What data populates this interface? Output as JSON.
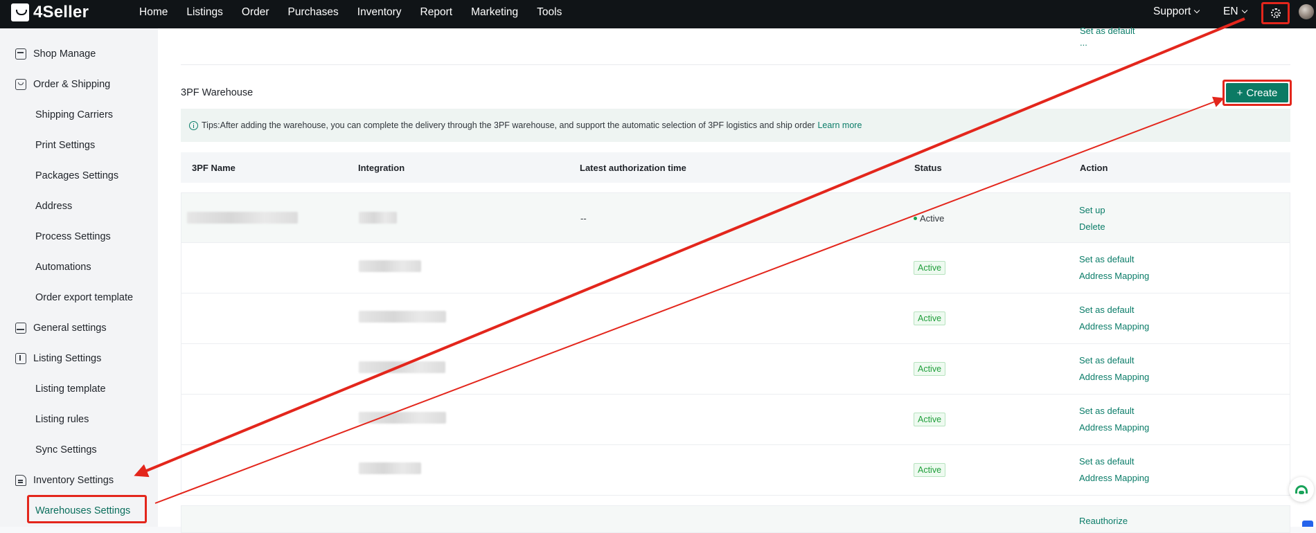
{
  "app": {
    "name": "4Seller"
  },
  "topnav": {
    "items": [
      "Home",
      "Listings",
      "Order",
      "Purchases",
      "Inventory",
      "Report",
      "Marketing",
      "Tools"
    ],
    "support": "Support",
    "language": "EN"
  },
  "sidebar": {
    "groups": [
      {
        "label": "Shop Manage",
        "icon": "store-icon"
      },
      {
        "label": "Order & Shipping",
        "icon": "order-bag-icon",
        "children": [
          "Shipping Carriers",
          "Print Settings",
          "Packages Settings",
          "Address",
          "Process Settings",
          "Automations",
          "Order export template"
        ]
      },
      {
        "label": "General settings",
        "icon": "printer-icon"
      },
      {
        "label": "Listing Settings",
        "icon": "upload-box-icon",
        "children": [
          "Listing template",
          "Listing rules",
          "Sync Settings"
        ]
      },
      {
        "label": "Inventory Settings",
        "icon": "warehouse-icon",
        "children": [
          "Warehouses Settings"
        ]
      }
    ],
    "active": "Warehouses Settings"
  },
  "main": {
    "top_link": "Set as default",
    "top_ellipsis": "...",
    "section_title": "3PF Warehouse",
    "create_button": "Create",
    "tips": "Tips:After adding the warehouse, you can complete the delivery through the 3PF warehouse, and support the automatic selection of 3PF logistics and ship order",
    "learn_more": "Learn more",
    "table": {
      "headers": [
        "3PF Name",
        "Integration",
        "Latest authorization time",
        "Status",
        "Action"
      ],
      "rows": [
        {
          "time": "--",
          "status": "Active",
          "status_style": "dot",
          "actions": [
            "Set up",
            "Delete"
          ]
        },
        {
          "time": "",
          "status": "Active",
          "status_style": "badge",
          "actions": [
            "Set as default",
            "Address Mapping"
          ]
        },
        {
          "time": "",
          "status": "Active",
          "status_style": "badge",
          "actions": [
            "Set as default",
            "Address Mapping"
          ]
        },
        {
          "time": "",
          "status": "Active",
          "status_style": "badge",
          "actions": [
            "Set as default",
            "Address Mapping"
          ]
        },
        {
          "time": "",
          "status": "Active",
          "status_style": "badge",
          "actions": [
            "Set as default",
            "Address Mapping"
          ]
        },
        {
          "time": "",
          "status": "Active",
          "status_style": "badge",
          "actions": [
            "Set as default",
            "Address Mapping"
          ]
        }
      ],
      "partial_row_action": "Reauthorize"
    }
  },
  "colors": {
    "accent": "#0b7a64",
    "annotation": "#e3261c",
    "topbar": "#101417",
    "status_green": "#1f9e3a"
  }
}
